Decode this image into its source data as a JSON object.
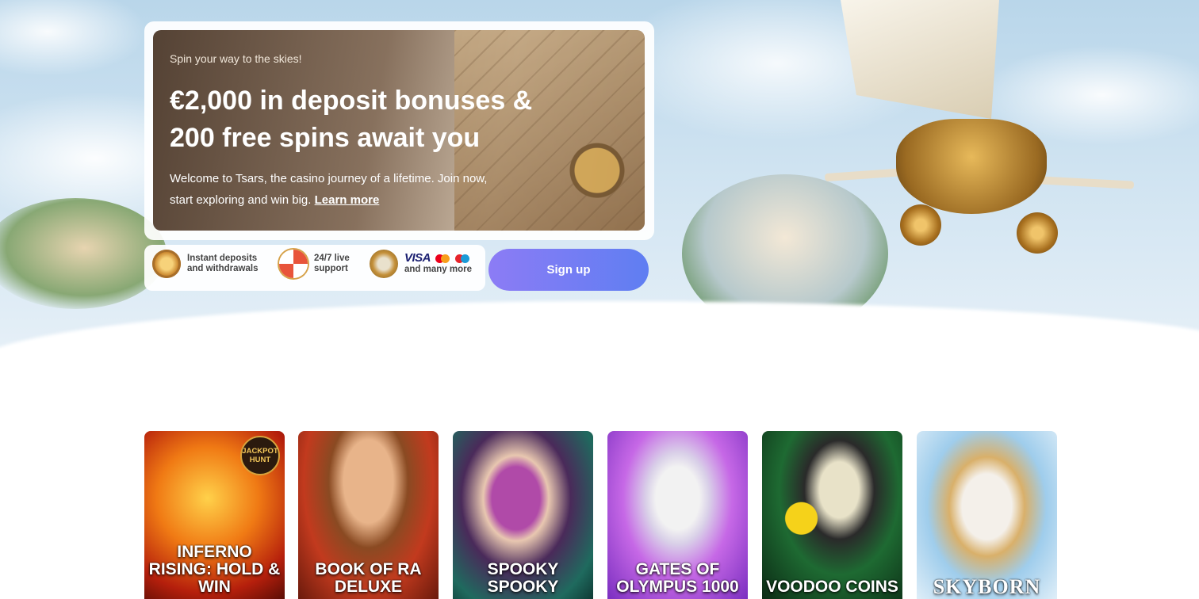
{
  "hero": {
    "eyebrow": "Spin your way to the skies!",
    "headline_line1": "€2,000 in deposit bonuses &",
    "headline_line2": "200 free spins await you",
    "description_line1": "Welcome to Tsars, the casino journey of a lifetime. Join now,",
    "description_line2": "start exploring and win big.",
    "learn_more": "Learn more"
  },
  "features": [
    {
      "icon": "lightning-coin-icon",
      "line1": "Instant deposits",
      "line2": "and withdrawals"
    },
    {
      "icon": "lifebuoy-icon",
      "line1": "24/7 live",
      "line2": "support"
    },
    {
      "icon": "payment-coin-icon",
      "brand": "VISA",
      "line2": "and many more"
    }
  ],
  "signup_label": "Sign up",
  "games": [
    {
      "title": "INFERNO RISING: HOLD & WIN",
      "badge": "JACKPOT HUNT",
      "colors": [
        "#f2a21f",
        "#c2260f"
      ]
    },
    {
      "title": "BOOK OF RA DELUXE",
      "colors": [
        "#d84a2a",
        "#7a2511"
      ]
    },
    {
      "title": "SPOOKY SPOOKY",
      "colors": [
        "#6b2f5f",
        "#1f7a6a"
      ]
    },
    {
      "title": "GATES OF OLYMPUS 1000",
      "colors": [
        "#c96ee8",
        "#7b2fc0"
      ]
    },
    {
      "title": "VOODOO COINS",
      "colors": [
        "#1e6a32",
        "#0f3a1a"
      ]
    },
    {
      "title": "SKYBORN",
      "colors": [
        "#a9d6f2",
        "#e8f1f8"
      ]
    }
  ],
  "colors": {
    "accent_start": "#8c7cf5",
    "accent_end": "#5f7ef2"
  }
}
